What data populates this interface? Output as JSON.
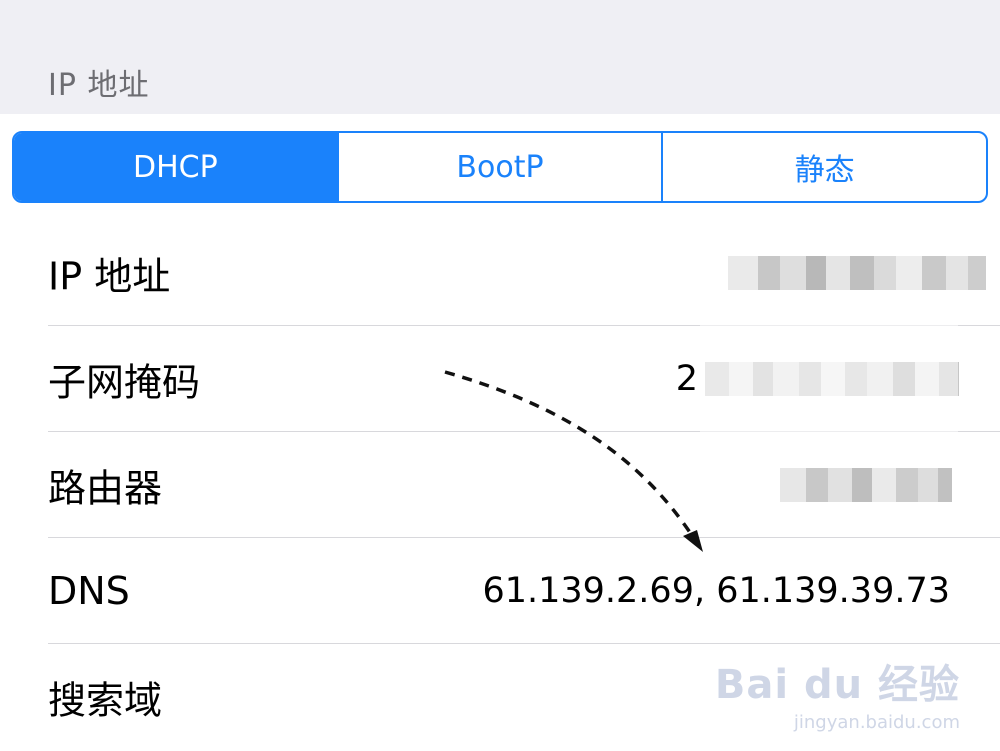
{
  "header": {
    "title": "IP 地址"
  },
  "segmented_control": {
    "options": [
      {
        "label": "DHCP",
        "selected": true
      },
      {
        "label": "BootP",
        "selected": false
      },
      {
        "label": "静态",
        "selected": false
      }
    ],
    "accent_color": "#1a82fb"
  },
  "rows": [
    {
      "label": "IP 地址",
      "value": ""
    },
    {
      "label": "子网掩码",
      "value": "2"
    },
    {
      "label": "路由器",
      "value": ""
    },
    {
      "label": "DNS",
      "value": "61.139.2.69, 61.139.39.73"
    },
    {
      "label": "搜索域",
      "value": ""
    }
  ],
  "watermark": {
    "logo_text": "Bai du 经验",
    "url": "jingyan.baidu.com"
  }
}
